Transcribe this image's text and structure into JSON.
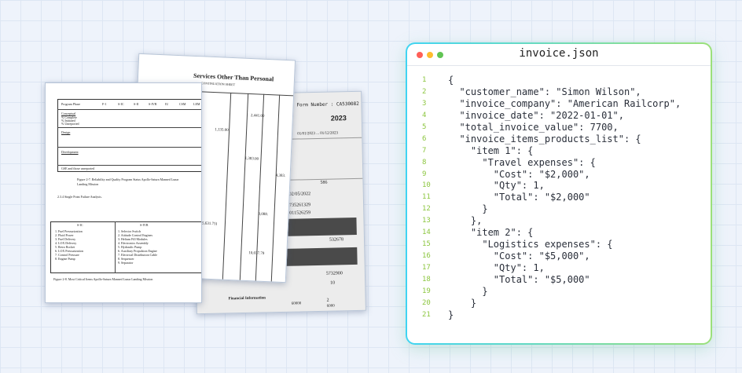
{
  "documents": {
    "table_doc": {
      "table_headers": [
        "Program Phase",
        "F-1",
        "S-IC",
        "S-II",
        "S-IVB",
        "IU",
        "CSM",
        "LEM"
      ],
      "sections": [
        "Conceptual",
        "Design",
        "Development"
      ],
      "rows": [
        "% Complete",
        "% Initiated",
        "% Unreported"
      ],
      "note": "GSE and those unreported",
      "figure_caption_1": "Figure 2-7. Reliability and Quality Program Status Apollo-Saturn Manned Lunar Landing Mission",
      "section_heading": "2.3.4 Single Point Failure Analysis.",
      "list_headers": [
        "S-IC",
        "S-IVB"
      ],
      "list_left": [
        "1. Fuel Pressurization",
        "2. Fluid Power",
        "3. Fuel Delivery",
        "4. LOX Delivery",
        "5. Retro Rocket",
        "6. LOX Pressurization",
        "7. Control Pressure",
        "8. Engine Pump"
      ],
      "list_right": [
        "1. Selector Switch",
        "2. Attitude Control Engines",
        "3. Helium Fill Modules",
        "4. Electronics Assembly",
        "5. Hydraulic Pump",
        "6. Auxiliary Propulsion Engine",
        "7. Electrical Distribution Cable",
        "8. Sequencer",
        "9. Separator"
      ],
      "figure_caption_2": "Figure 2-8. Most Critical Items Apollo-Saturn Manned Lunar Landing Mission"
    },
    "services_doc": {
      "title": "Services Other Than Personal",
      "subtitle": "CONTINUATION SHEET",
      "values": [
        "2,441.00",
        "1,135.00",
        "1,383.00",
        "4,383.",
        "3,088.",
        "(85,631.75)",
        "10,037.79"
      ]
    },
    "form_doc": {
      "form_number": "Form Number : CA530082",
      "year": "2023",
      "dates": "01/01/2023 ... 01/12/2023",
      "handwritten": [
        "586",
        "02/05/2022",
        "735261329",
        "011526259",
        "532678",
        "5732900",
        "10",
        "2",
        "60000",
        "6000"
      ],
      "section": "Financial Information"
    }
  },
  "code_window": {
    "title": "invoice.json",
    "colors": {
      "close": "#ff5f57",
      "minimize": "#febc2e",
      "maximize": "#61c454",
      "line_numbers": "#8cc63f",
      "border_start": "#3fd4f2",
      "border_end": "#9be07a"
    },
    "lines": [
      "{",
      "  \"customer_name\": \"Simon Wilson\",",
      "  \"invoice_company\": \"American Railcorp\",",
      "  \"invoice_date\": \"2022-01-01\",",
      "  \"total_invoice_value\": 7700,",
      "  \"invoice_items_products_list\": {",
      "    \"item 1\": {",
      "      \"Travel expenses\": {",
      "        \"Cost\": \"$2,000\",",
      "        \"Qty\": 1,",
      "        \"Total\": \"$2,000\"",
      "      }",
      "    },",
      "    \"item 2\": {",
      "      \"Logistics expenses\": {",
      "        \"Cost\": \"$5,000\",",
      "        \"Qty\": 1,",
      "        \"Total\": \"$5,000\"",
      "      }",
      "    }",
      "}"
    ]
  }
}
